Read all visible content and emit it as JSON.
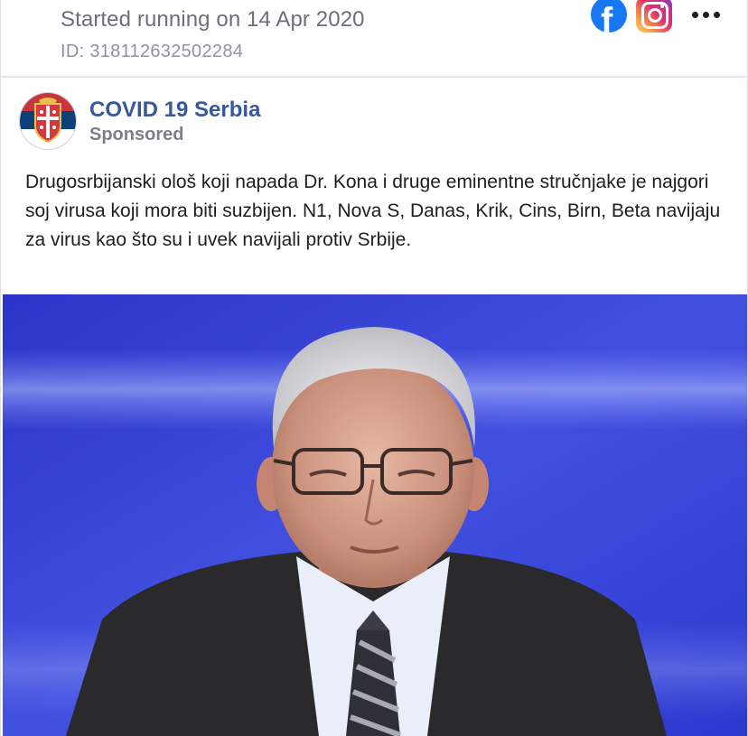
{
  "ad_library": {
    "status": "Started running on 14 Apr 2020",
    "id": "ID: 318112632502284",
    "platforms": [
      "facebook-icon",
      "instagram-icon"
    ],
    "more_icon": "more-options-icon"
  },
  "post": {
    "page_name": "COVID 19 Serbia",
    "sponsored_label": "Sponsored",
    "body": "Drugosrbijanski ološ koji napada Dr. Kona i druge eminentne stručnjake je najgori soj virusa koji mora biti suzbijen. N1, Nova S, Danas, Krik, Cins, Birn, Beta navijaju za virus kao što su i uvek navijali protiv Srbije.",
    "image": "photo-man-with-glasses-blue-studio"
  },
  "colors": {
    "page_name": "#385898",
    "facebook": "#1877f2",
    "studio_blue": "#3a46d6"
  }
}
